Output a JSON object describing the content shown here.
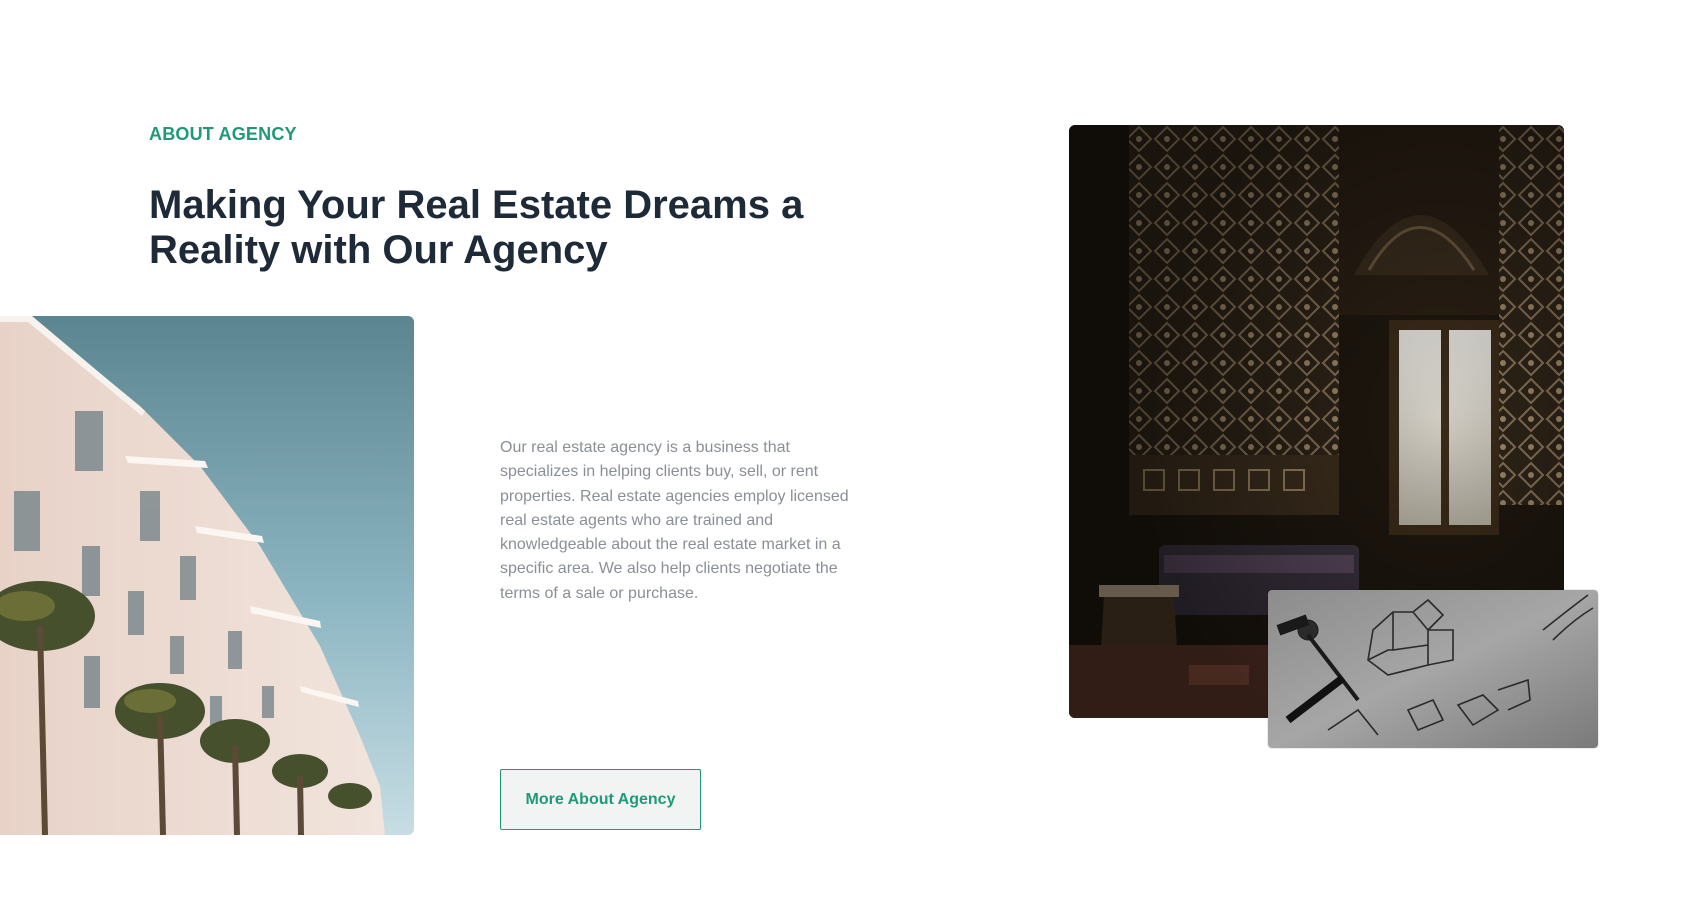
{
  "about": {
    "eyebrow": "ABOUT AGENCY",
    "headline": "Making Your Real Estate Dreams a Reality with Our Agency",
    "description": "Our real estate agency is a business that specializes in helping clients buy, sell, or rent properties. Real estate agencies employ licensed real estate agents who are trained and knowledgeable about the real estate market in a specific area. We also help clients negotiate the terms of a sale or purchase.",
    "cta_label": "More About Agency"
  },
  "images": {
    "building": "building-photo",
    "interior": "interior-photo",
    "sketch": "blueprint-sketch-photo"
  },
  "colors": {
    "accent": "#1f9a78",
    "heading": "#1f2a38",
    "body_text": "#8a8f96",
    "button_bg": "#f2f4f3"
  }
}
